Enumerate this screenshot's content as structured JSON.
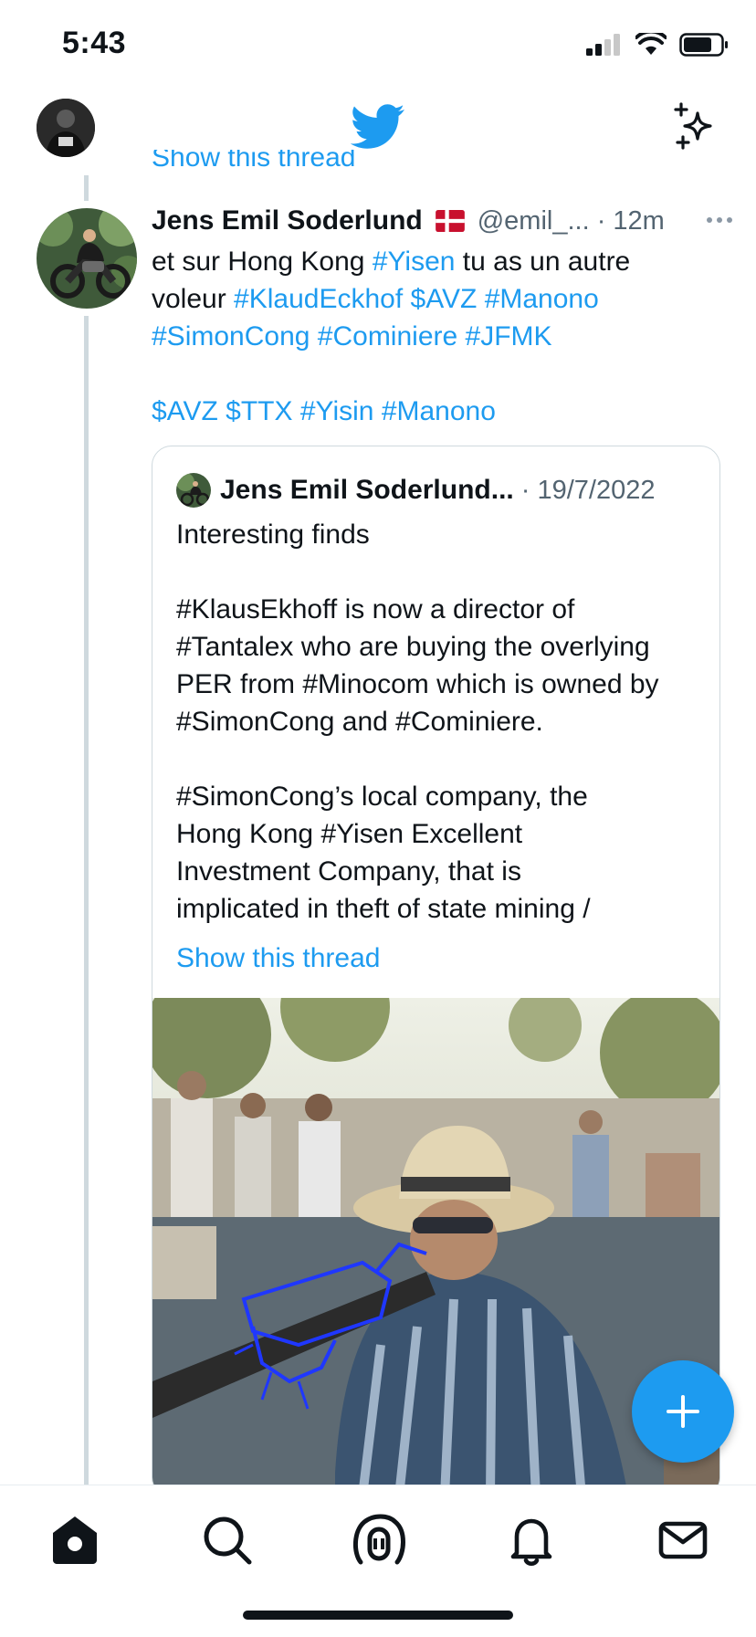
{
  "status_bar": {
    "time": "5:43"
  },
  "thread": {
    "partial_link": "Show this thread"
  },
  "tweet": {
    "author_name": "Jens Emil Soderlund",
    "handle_time": "@emil_... · 12m",
    "text_lines": [
      [
        {
          "t": "et sur Hong Kong "
        },
        {
          "t": "#Yisen",
          "tag": true
        },
        {
          "t": " tu as un autre"
        }
      ],
      [
        {
          "t": "voleur "
        },
        {
          "t": "#KlaudEckhof",
          "tag": true
        },
        {
          "t": " "
        },
        {
          "t": "$AVZ",
          "tag": true
        },
        {
          "t": " "
        },
        {
          "t": "#Manono",
          "tag": true
        }
      ],
      [
        {
          "t": "#SimonCong",
          "tag": true
        },
        {
          "t": " "
        },
        {
          "t": "#Cominiere",
          "tag": true
        },
        {
          "t": " "
        },
        {
          "t": "#JFMK",
          "tag": true
        }
      ],
      [],
      [
        {
          "t": "$AVZ",
          "tag": true
        },
        {
          "t": " "
        },
        {
          "t": "$TTX",
          "tag": true
        },
        {
          "t": " "
        },
        {
          "t": "#Yisin",
          "tag": true
        },
        {
          "t": " "
        },
        {
          "t": "#Manono",
          "tag": true
        }
      ]
    ]
  },
  "quote": {
    "author_name": "Jens Emil Soderlund...",
    "date": "· 19/7/2022",
    "text_lines": [
      "Interesting finds",
      "",
      "#KlausEkhoff is now a director of",
      "#Tantalex who are buying the overlying",
      "PER from #Minocom which is owned by",
      "#SimonCong and #Cominiere.",
      "",
      "#SimonCong’s local company, the",
      "Hong Kong #Yisen Excellent",
      "Investment Company, that is",
      "implicated in theft of state mining /"
    ],
    "show_thread": "Show this thread"
  },
  "colors": {
    "link": "#1d9bf0",
    "secondary_text": "#536471",
    "border": "#cfd9de",
    "fab": "#1d9bf0"
  },
  "icons": {
    "nav": [
      "twitter-bird-icon",
      "sparkle-icon"
    ],
    "tabs": [
      "home-icon",
      "search-icon",
      "spaces-icon",
      "notifications-icon",
      "messages-icon"
    ],
    "fab": "plus-icon"
  }
}
